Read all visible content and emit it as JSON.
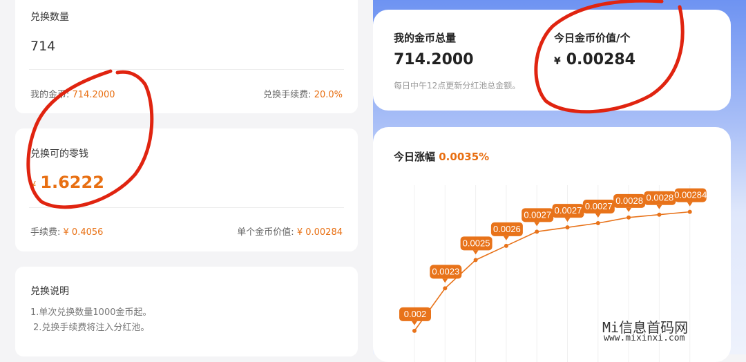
{
  "left": {
    "exchange_qty": {
      "label": "兑换数量",
      "value": "714"
    },
    "my_coins": {
      "label": "我的金币:",
      "value": "714.2000"
    },
    "fee_rate": {
      "label": "兑换手续费:",
      "value": "20.0%"
    },
    "exchangeable": {
      "label": "兑换可的零钱",
      "currency": "¥",
      "value": "1.6222"
    },
    "fee": {
      "label": "手续费:",
      "value": "¥ 0.4056"
    },
    "unit_value": {
      "label": "单个金币价值:",
      "value": "¥ 0.00284"
    },
    "instructions": {
      "title": "兑换说明",
      "lines": [
        "1.单次兑换数量1000金币起。",
        "2.兑换手续费将注入分红池。"
      ]
    }
  },
  "right": {
    "total_coins": {
      "label": "我的金币总量",
      "value": "714.2000"
    },
    "today_value": {
      "label": "今日金币价值/个",
      "currency": "¥",
      "value": "0.00284"
    },
    "update_note": "每日中午12点更新分红池总金额。",
    "growth": {
      "label": "今日涨幅",
      "value": "0.0035%"
    }
  },
  "chart_data": {
    "type": "line",
    "values": [
      0.002,
      0.0023,
      0.0025,
      0.0026,
      0.0027,
      0.00273,
      0.00276,
      0.0028,
      0.00282,
      0.00284
    ],
    "labels": [
      "0.002",
      "0.0023",
      "0.0025",
      "0.0026",
      "0.0027",
      "0.0027",
      "0.0027",
      "0.0028",
      "0.0028",
      "0.00284"
    ],
    "ylim": [
      0.00178,
      0.00296
    ],
    "colors": {
      "line": "#e8731a",
      "label_bg": "#e8731a",
      "label_text": "#ffffff",
      "grid": "#f0f0f0"
    }
  },
  "watermark": {
    "title": "Mi信息首码网",
    "url": "www.mixinxi.com"
  },
  "annotation_color": "#e02410"
}
